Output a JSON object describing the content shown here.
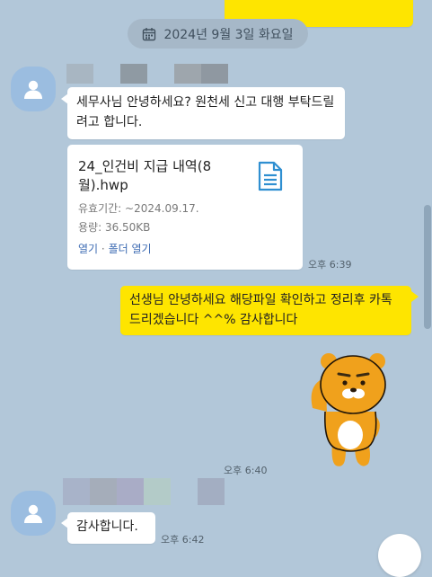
{
  "chat": {
    "date_divider": "2024년 9월 3일 화요일",
    "messages": [
      {
        "text": "세무사님 안녕하세요? 원천세 신고 대행 부탁드릴려고 합니다."
      },
      {
        "file": {
          "name": "24_인건비 지급 내역(8월).hwp",
          "expiry_label": "유효기간:",
          "expiry_value": "~2024.09.17.",
          "size_label": "용량:",
          "size_value": "36.50KB",
          "open_label": "열기",
          "separator": "·",
          "open_folder_label": "폴더 열기"
        },
        "time": "오후 6:39"
      },
      {
        "text": "선생님 안녕하세요 해당파일 확인하고 정리후 카톡드리겠습니다 ^^% 감사합니다"
      },
      {
        "sticker": "lion-character-sticker",
        "time": "오후 6:40"
      },
      {
        "text": "감사합니다.",
        "time": "오후 6:42"
      }
    ]
  },
  "colors": {
    "background": "#b2c7d9",
    "my_bubble": "#fee500",
    "other_bubble": "#ffffff",
    "link": "#3d6bb3"
  },
  "icons": {
    "date": "calendar-icon",
    "avatar": "default-profile-icon",
    "file": "document-icon"
  }
}
